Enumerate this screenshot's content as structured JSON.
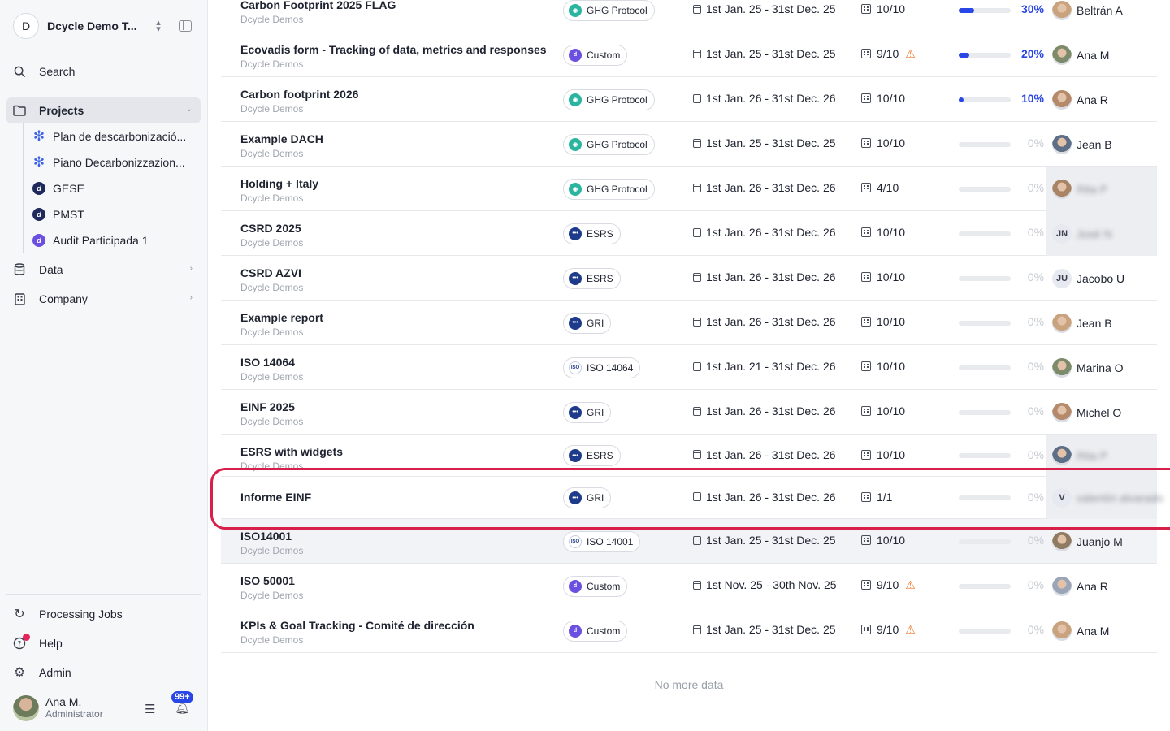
{
  "workspace": {
    "initial": "D",
    "name": "Dcycle Demo T..."
  },
  "sidebar": {
    "search": "Search",
    "projects": "Projects",
    "project_items": [
      {
        "label": "Plan de descarbonizació...",
        "icon": "snowflake-icon",
        "color": "#3b62e6"
      },
      {
        "label": "Piano Decarbonizzazion...",
        "icon": "snowflake-icon",
        "color": "#3b62e6"
      },
      {
        "label": "GESE",
        "icon": "dcycle-logo-icon",
        "color": "#1f2a5c"
      },
      {
        "label": "PMST",
        "icon": "dcycle-logo-icon",
        "color": "#1f2a5c"
      },
      {
        "label": "Audit Participada 1",
        "icon": "dcycle-logo-icon",
        "color": "#6a4fe0"
      }
    ],
    "data": "Data",
    "company": "Company",
    "processing_jobs": "Processing Jobs",
    "help": "Help",
    "admin": "Admin"
  },
  "profile": {
    "name": "Ana M.",
    "role": "Administrator",
    "notifications": "99+"
  },
  "table": {
    "rows": [
      {
        "title": "Carbon Footprint 2025 FLAG",
        "org": "Dcycle Demos",
        "framework": "GHG Protocol",
        "fw_icon": "ghg-icon",
        "period": "1st Jan. 25 - 31st Dec. 25",
        "count": "10/10",
        "warning": false,
        "progress": 30,
        "pct": "30%",
        "owner": "Beltrán A",
        "owner_blur": false,
        "owner_initials": ""
      },
      {
        "title": "Ecovadis form - Tracking of data, metrics and responses",
        "org": "Dcycle Demos",
        "framework": "Custom",
        "fw_icon": "custom-icon",
        "period": "1st Jan. 25 - 31st Dec. 25",
        "count": "9/10",
        "warning": true,
        "progress": 20,
        "pct": "20%",
        "owner": "Ana M",
        "owner_blur": false,
        "owner_initials": ""
      },
      {
        "title": "Carbon footprint 2026",
        "org": "Dcycle Demos",
        "framework": "GHG Protocol",
        "fw_icon": "ghg-icon",
        "period": "1st Jan. 26 - 31st Dec. 26",
        "count": "10/10",
        "warning": false,
        "progress": 10,
        "pct": "10%",
        "owner": "Ana R",
        "owner_blur": false,
        "owner_initials": ""
      },
      {
        "title": "Example DACH",
        "org": "Dcycle Demos",
        "framework": "GHG Protocol",
        "fw_icon": "ghg-icon",
        "period": "1st Jan. 25 - 31st Dec. 25",
        "count": "10/10",
        "warning": false,
        "progress": 0,
        "pct": "0%",
        "owner": "Jean B",
        "owner_blur": false,
        "owner_initials": ""
      },
      {
        "title": "Holding + Italy",
        "org": "Dcycle Demos",
        "framework": "GHG Protocol",
        "fw_icon": "ghg-icon",
        "period": "1st Jan. 26 - 31st Dec. 26",
        "count": "4/10",
        "warning": false,
        "progress": 0,
        "pct": "0%",
        "owner": "Rita P",
        "owner_blur": true,
        "owner_initials": ""
      },
      {
        "title": "CSRD 2025",
        "org": "Dcycle Demos",
        "framework": "ESRS",
        "fw_icon": "esrs-icon",
        "period": "1st Jan. 26 - 31st Dec. 26",
        "count": "10/10",
        "warning": false,
        "progress": 0,
        "pct": "0%",
        "owner": "José N",
        "owner_blur": true,
        "owner_initials": "JN"
      },
      {
        "title": "CSRD AZVI",
        "org": "Dcycle Demos",
        "framework": "ESRS",
        "fw_icon": "esrs-icon",
        "period": "1st Jan. 26 - 31st Dec. 26",
        "count": "10/10",
        "warning": false,
        "progress": 0,
        "pct": "0%",
        "owner": "Jacobo U",
        "owner_blur": false,
        "owner_initials": "JU"
      },
      {
        "title": "Example report",
        "org": "Dcycle Demos",
        "framework": "GRI",
        "fw_icon": "gri-icon",
        "period": "1st Jan. 26 - 31st Dec. 26",
        "count": "10/10",
        "warning": false,
        "progress": 0,
        "pct": "0%",
        "owner": "Jean B",
        "owner_blur": false,
        "owner_initials": ""
      },
      {
        "title": "ISO 14064",
        "org": "Dcycle Demos",
        "framework": "ISO 14064",
        "fw_icon": "iso-icon",
        "period": "1st Jan. 21 - 31st Dec. 26",
        "count": "10/10",
        "warning": false,
        "progress": 0,
        "pct": "0%",
        "owner": "Marina O",
        "owner_blur": false,
        "owner_initials": ""
      },
      {
        "title": "EINF 2025",
        "org": "Dcycle Demos",
        "framework": "GRI",
        "fw_icon": "gri-icon",
        "period": "1st Jan. 26 - 31st Dec. 26",
        "count": "10/10",
        "warning": false,
        "progress": 0,
        "pct": "0%",
        "owner": "Michel O",
        "owner_blur": false,
        "owner_initials": ""
      },
      {
        "title": "ESRS with widgets",
        "org": "Dcycle Demos",
        "framework": "ESRS",
        "fw_icon": "esrs-icon",
        "period": "1st Jan. 26 - 31st Dec. 26",
        "count": "10/10",
        "warning": false,
        "progress": 0,
        "pct": "0%",
        "owner": "Rita P",
        "owner_blur": true,
        "owner_initials": ""
      },
      {
        "title": "Informe EINF",
        "org": "",
        "framework": "GRI",
        "fw_icon": "gri-icon",
        "period": "1st Jan. 26 - 31st Dec. 26",
        "count": "1/1",
        "warning": false,
        "progress": 0,
        "pct": "0%",
        "owner": "valentín alvarado",
        "owner_blur": true,
        "owner_initials": "V"
      },
      {
        "title": "ISO14001",
        "org": "Dcycle Demos",
        "framework": "ISO 14001",
        "fw_icon": "iso-icon",
        "period": "1st Jan. 25 - 31st Dec. 25",
        "count": "10/10",
        "warning": false,
        "progress": 0,
        "pct": "0%",
        "owner": "Juanjo M",
        "owner_blur": false,
        "owner_initials": ""
      },
      {
        "title": "ISO 50001",
        "org": "Dcycle Demos",
        "framework": "Custom",
        "fw_icon": "custom-icon",
        "period": "1st Nov. 25 - 30th Nov. 25",
        "count": "9/10",
        "warning": true,
        "progress": 0,
        "pct": "0%",
        "owner": "Ana R",
        "owner_blur": false,
        "owner_initials": ""
      },
      {
        "title": "KPIs & Goal Tracking - Comité de dirección",
        "org": "Dcycle Demos",
        "framework": "Custom",
        "fw_icon": "custom-icon",
        "period": "1st Jan. 25 - 31st Dec. 25",
        "count": "9/10",
        "warning": true,
        "progress": 0,
        "pct": "0%",
        "owner": "Ana M",
        "owner_blur": false,
        "owner_initials": ""
      }
    ],
    "no_more": "No more data"
  },
  "colors": {
    "accent": "#2946e6",
    "highlight": "#d81f4a",
    "warning": "#f07a2e"
  }
}
